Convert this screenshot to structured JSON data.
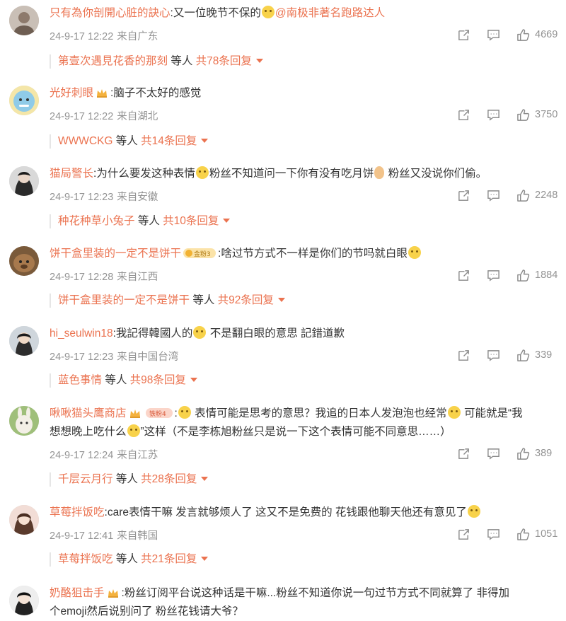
{
  "comments": [
    {
      "username": "只有為你剖開心脏的訣心",
      "text_a": ":又一位晚节不保的",
      "mention": "@南极非著名跑路达人",
      "date": "24-9-17 12:22",
      "location": "来自广东",
      "likes": "4669",
      "reply_user": "第壹次遇見花香的那刻",
      "reply_and": "等人",
      "reply_total": "共78条回复"
    },
    {
      "username": "光好刺眼",
      "text_a": ":脑子不太好的感觉",
      "date": "24-9-17 12:22",
      "location": "来自湖北",
      "likes": "3750",
      "reply_user": "WWWCKG",
      "reply_and": "等人",
      "reply_total": "共14条回复"
    },
    {
      "username": "猫局警长",
      "text_a": ":为什么要发这种表情",
      "text_b": "粉丝不知道问一下你有没有吃月饼",
      "text_c": "粉丝又没说你们偷。",
      "date": "24-9-17 12:23",
      "location": "来自安徽",
      "likes": "2248",
      "reply_user": "种花种草小兔子",
      "reply_and": "等人",
      "reply_total": "共10条回复"
    },
    {
      "username": "饼干盒里装的一定不是饼干",
      "badge": "金粉3",
      "text_a": ":啥过节方式不一样是你们的节吗就白眼",
      "date": "24-9-17 12:28",
      "location": "来自江西",
      "likes": "1884",
      "reply_user": "饼干盒里装的一定不是饼干",
      "reply_and": "等人",
      "reply_total": "共92条回复"
    },
    {
      "username": "hi_seulwin18",
      "text_a": ":我記得韓國人的",
      "text_b": "不是翻白眼的意思 記錯道歉",
      "date": "24-9-17 12:23",
      "location": "来自中国台湾",
      "likes": "339",
      "reply_user": "蓝色事情",
      "reply_and": "等人",
      "reply_total": "共98条回复"
    },
    {
      "username": "啾啾猫头鹰商店",
      "badge": "铁粉4",
      "text_a": ":",
      "text_b": "表情可能是思考的意思？我追的日本人发泡泡也经常",
      "text_c": "可能就是“我",
      "text_d": "想想晚上吃什么",
      "text_e": "”这样（不是李栋旭粉丝只是说一下这个表情可能不同意思……）",
      "date": "24-9-17 12:24",
      "location": "来自江苏",
      "likes": "389",
      "reply_user": "千层云月行",
      "reply_and": "等人",
      "reply_total": "共28条回复"
    },
    {
      "username": "草莓拌饭吃",
      "text_a": ":care表情干嘛 发言就够烦人了 这又不是免费的 花钱跟他聊天他还有意见了",
      "date": "24-9-17 12:41",
      "location": "来自韩国",
      "likes": "1051",
      "reply_user": "草莓拌饭吃",
      "reply_and": "等人",
      "reply_total": "共21条回复"
    },
    {
      "username": "奶酪狙击手",
      "text_a": ":粉丝订阅平台说这种话是干嘛...粉丝不知道你说一句过节方式不同就算了 非得加",
      "text_b": "个emoji然后说别问了 粉丝花钱请大爷？"
    }
  ],
  "colors": {
    "accent": "#eb7350",
    "meta": "#939393",
    "text": "#333333"
  },
  "icons": {
    "share": "share-icon",
    "comment": "comment-icon",
    "like": "thumbs-up-icon",
    "expand": "chevron-down-icon"
  }
}
